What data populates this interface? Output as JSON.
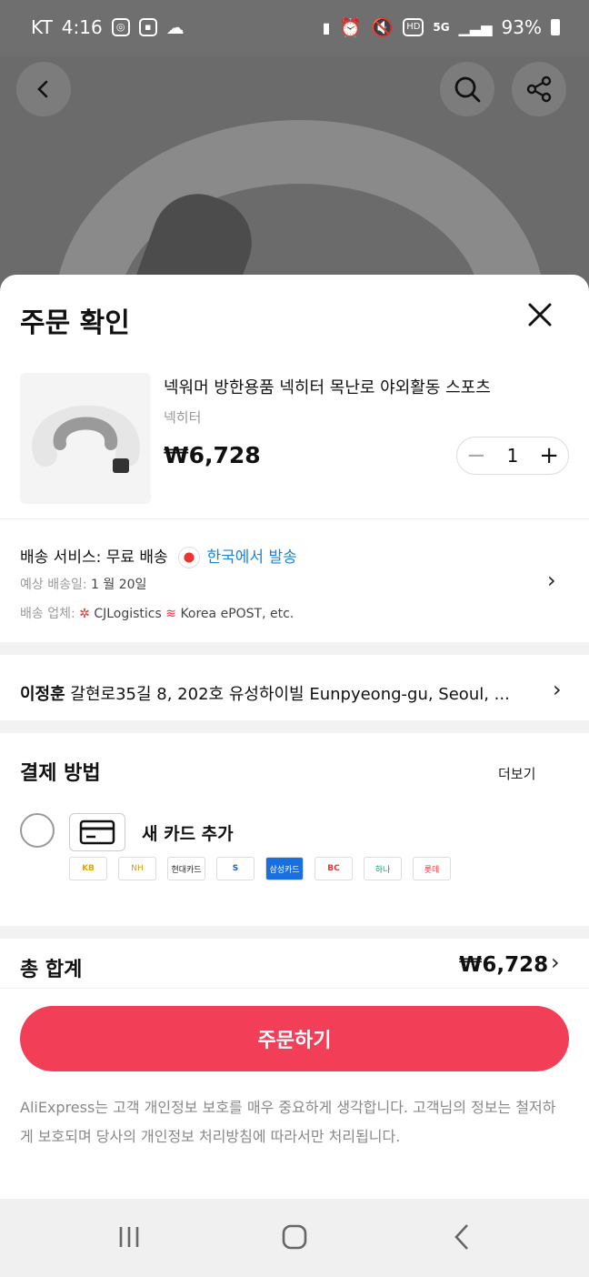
{
  "status_bar": {
    "carrier": "KT",
    "time": "4:16",
    "network": "5G",
    "hd_label": "HD",
    "battery": "93%"
  },
  "sheet": {
    "title": "주문 확인"
  },
  "product": {
    "name": "넥워머 방한용품 넥히터 목난로 야외활동 스포츠",
    "brand": "넥히터",
    "price": "₩6,728",
    "quantity": "1"
  },
  "shipping": {
    "service_prefix": "배송 서비스: 무료 배송",
    "origin": "한국에서 발송",
    "eta_label": "예상 배송일:",
    "eta_value": "1 월 20일",
    "carrier_label": "배송 업체:",
    "carrier_value_1": "CJLogistics",
    "carrier_value_2": "Korea ePOST, etc."
  },
  "address": {
    "name": "이정훈",
    "text": "갈현로35길 8, 202호 유성하이빌 Eunpyeong-gu, Seoul, ..."
  },
  "payment": {
    "title": "결제 방법",
    "more_label": "더보기",
    "new_card_label": "새 카드 추가",
    "banks": [
      "KB",
      "NH",
      "현대카드",
      "S",
      "삼성카드",
      "BC",
      "하나",
      "롯데"
    ]
  },
  "total": {
    "label": "총 합계",
    "value": "₩6,728"
  },
  "order_button": {
    "label": "주문하기"
  },
  "notice": "AliExpress는 고객 개인정보 보호를 매우 중요하게 생각합니다. 고객님의 정보는 철저하게 보호되며 당사의 개인정보 처리방침에 따라서만 처리됩니다.",
  "colors": {
    "accent": "#f33e57",
    "link_blue": "#1a86d0",
    "overlay": "#6f6f6f"
  }
}
